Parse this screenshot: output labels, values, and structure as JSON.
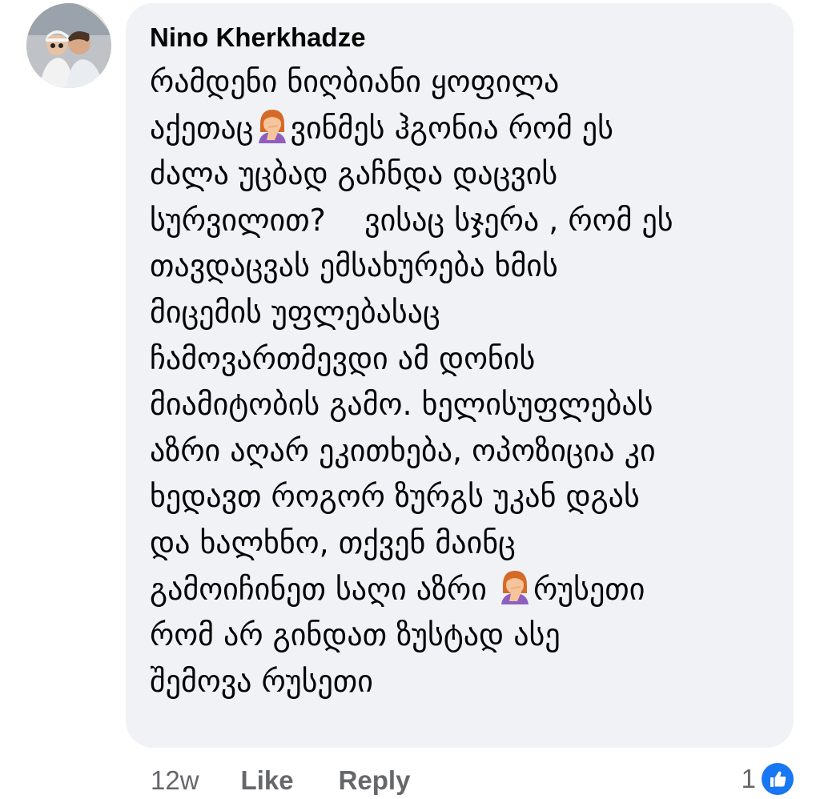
{
  "comment": {
    "author": "Nino Kherkhadze",
    "lines": [
      "რამდენი ნიღბიანი ყოფილა",
      "აქეთაც",
      "ვინმეს ჰგონია რომ ეს",
      "ძალა უცბად გაჩნდა დაცვის",
      "სურვილით?    ვისაც სჯერა , რომ ეს",
      "თავდაცვას ემსახურება ხმის",
      "მიცემის უფლებასაც",
      "ჩამოვართმევდი ამ დონის",
      "მიამიტობის გამო. ხელისუფლებას",
      "აზრი აღარ ეკითხება, ოპოზიცია კი",
      "ხედავთ როგორ ზურგს უკან დგას",
      "და ხალხნო, თქვენ მაინც",
      "გამოიჩინეთ საღი აზრი",
      "რუსეთი",
      "რომ არ გინდათ ზუსტად ასე",
      "შემოვა რუსეთი"
    ],
    "emoji_name": "facepalm-woman-emoji"
  },
  "actions": {
    "time": "12w",
    "like_label": "Like",
    "reply_label": "Reply"
  },
  "reactions": {
    "count": "1",
    "icon": "like-reaction-icon",
    "color": "#1877f2"
  },
  "colors": {
    "bubble": "#f0f2f5",
    "text": "#050505",
    "meta": "#65676b"
  }
}
